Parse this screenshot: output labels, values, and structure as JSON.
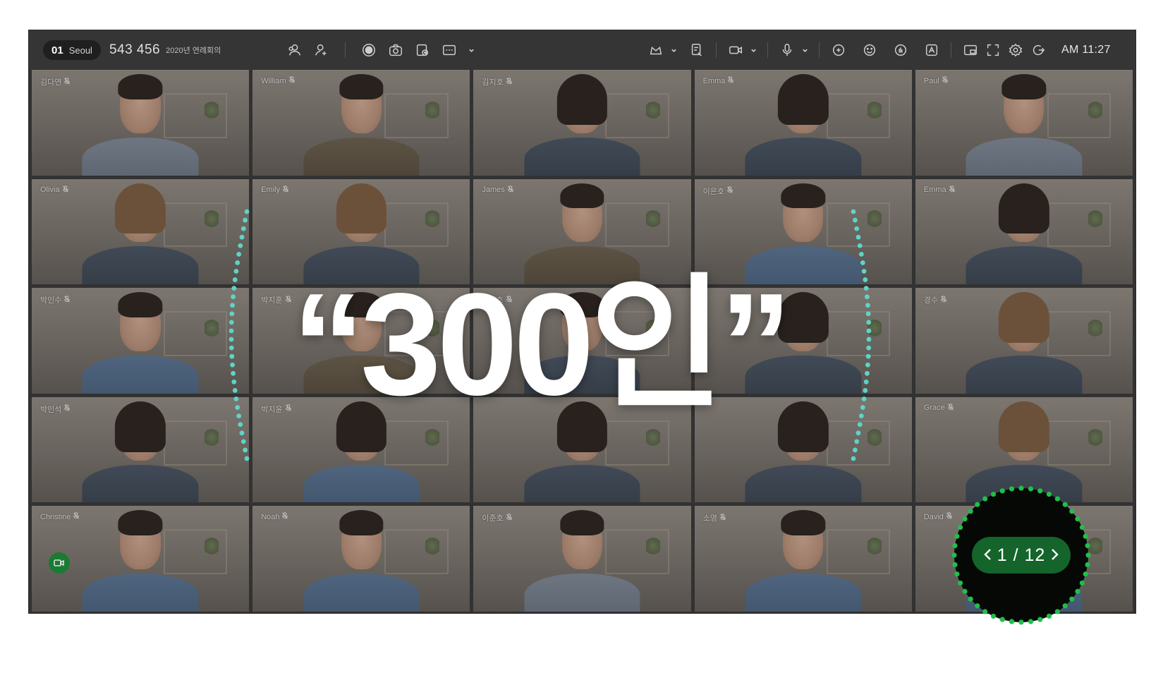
{
  "toolbar": {
    "room_number": "01",
    "room_city": "Seoul",
    "meeting_id": "543 456",
    "meeting_name": "2020년 연례회의",
    "clock": "AM 11:27"
  },
  "participants": [
    "김다연",
    "William",
    "김지호",
    "Emma",
    "Paul",
    "Olivia",
    "Emily",
    "James",
    "이은호",
    "Emma",
    "박인수",
    "박지훈",
    "안지호",
    "",
    "경수",
    "박인석",
    "박지윤",
    "",
    "",
    "Grace",
    "Christine",
    "Noah",
    "이준호",
    "소영",
    "David"
  ],
  "active_index": 9,
  "headline": "“300인”",
  "pager": {
    "current": "1",
    "total": "12",
    "label": "1 / 12"
  },
  "colors": {
    "accent_green": "#1f9d3f",
    "dot_teal": "#5fd3c6",
    "dot_green": "#1fbf49",
    "pager_pill": "#15642b"
  }
}
